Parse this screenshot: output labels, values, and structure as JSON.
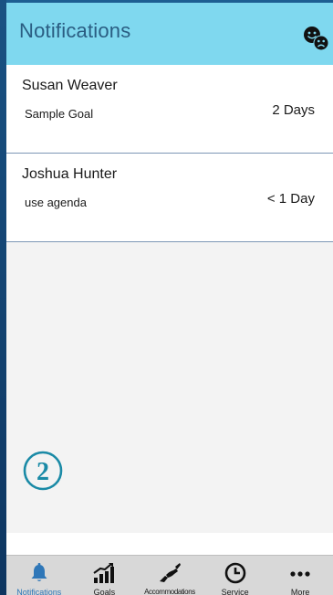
{
  "header": {
    "title": "Notifications"
  },
  "notifications": [
    {
      "name": "Susan Weaver",
      "goal": "Sample Goal",
      "time": "2 Days"
    },
    {
      "name": "Joshua Hunter",
      "goal": "use agenda",
      "time": "< 1 Day"
    }
  ],
  "badge": {
    "number": "2"
  },
  "tabs": [
    {
      "label": "Notifications",
      "icon": "bell-icon",
      "active": true
    },
    {
      "label": "Goals",
      "icon": "bar-chart-icon",
      "active": false
    },
    {
      "label": "Accommodations",
      "icon": "handshake-icon",
      "active": false
    },
    {
      "label": "Service",
      "icon": "clock-icon",
      "active": false
    },
    {
      "label": "More",
      "icon": "more-dots-icon",
      "active": false
    }
  ],
  "colors": {
    "header_bg": "#7fd8ef",
    "header_title": "#2a5d82",
    "active_tab": "#2f77b8",
    "badge": "#1a8aa6"
  }
}
